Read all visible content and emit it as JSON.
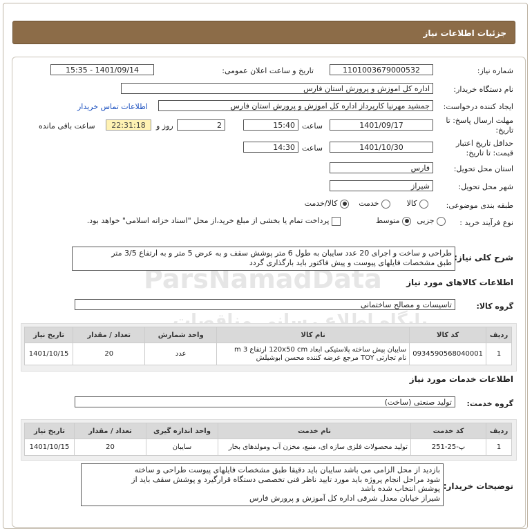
{
  "header": {
    "title": "جزئیات اطلاعات نیاز"
  },
  "fields": {
    "need_number_label": "شماره نیاز:",
    "need_number": "1101003679000532",
    "announce_label": "تاریخ و ساعت اعلان عمومی:",
    "announce_value": "1401/09/14 - 15:35",
    "buyer_org_label": "نام دستگاه خریدار:",
    "buyer_org": "اداره کل اموزش و پرورش استان فارس",
    "creator_label": "ایجاد کننده درخواست:",
    "creator": "جمشید مهرنیا کارپرداز اداره کل اموزش و پرورش استان فارس",
    "contact_link": "اطلاعات تماس خریدار",
    "deadline_label_1": "مهلت ارسال پاسخ: تا",
    "deadline_label_2": "تاریخ:",
    "deadline_date": "1401/09/17",
    "time_label": "ساعت",
    "deadline_time": "15:40",
    "days_value": "2",
    "days_label": "روز و",
    "remaining_time": "22:31:18",
    "remaining_label": "ساعت باقی مانده",
    "validity_label_1": "حداقل تاریخ اعتبار",
    "validity_label_2": "قیمت: تا تاریخ:",
    "validity_date": "1401/10/30",
    "validity_time": "14:30",
    "province_label": "استان محل تحویل:",
    "province": "فارس",
    "city_label": "شهر محل تحویل:",
    "city": "شیراز",
    "category_label": "طبقه بندی موضوعی:",
    "category_options": [
      "کالا",
      "خدمت",
      "کالا/خدمت"
    ],
    "process_label": "نوع فرآیند خرید :",
    "process_options": [
      "جزیی",
      "متوسط"
    ],
    "payment_note": "پرداخت تمام یا بخشی از مبلغ خرید،از محل \"اسناد خزانه اسلامی\" خواهد بود."
  },
  "summary": {
    "label": "شرح کلی نیاز:",
    "line1": "طراحی و ساخت و اجرای 20 عدد سایبان به طول 6 متر پوشش سقف و به عرض 5 متر و به ارتفاع 3/5 متر",
    "line2": "طبق مشخصات فایلهای پیوست  و پیش فاکتور باید بارگذاری گردد"
  },
  "goods": {
    "section_title": "اطلاعات کالاهای مورد نیاز",
    "group_label": "گروه کالا:",
    "group_value": "تاسیسات و مصالح ساختمانی",
    "columns": [
      "ردیف",
      "کد کالا",
      "نام کالا",
      "واحد شمارش",
      "تعداد / مقدار",
      "تاریخ نیاز"
    ],
    "rows": [
      {
        "idx": "1",
        "code": "0934590568040001",
        "name_1": "سایبان پیش ساخته پلاستیکی ابعاد 120x50 cm ارتفاع 3 m",
        "name_2": "نام تجارتی TOY مرجع عرضه کننده محسن ابوشیلش",
        "unit": "عدد",
        "qty": "20",
        "date": "1401/10/15"
      }
    ]
  },
  "services": {
    "section_title": "اطلاعات خدمات مورد نیاز",
    "group_label": "گروه خدمت:",
    "group_value": "تولید صنعتی (ساخت)",
    "columns": [
      "ردیف",
      "کد خدمت",
      "نام خدمت",
      "واحد اندازه گیری",
      "تعداد / مقدار",
      "تاریخ نیاز"
    ],
    "rows": [
      {
        "idx": "1",
        "code": "پ-25-251",
        "name": "تولید محصولات فلزی سازه ای، منبع، مخزن آب ومولدهای بخار",
        "unit": "سایبان",
        "qty": "20",
        "date": "1401/10/15"
      }
    ]
  },
  "notes": {
    "label": "توضیحات خریدار:",
    "lines": [
      "بازدید از محل الزامی می باشد سایبان باید دقیقا طبق مشخصات فایلهای پیوست طراحی و ساخته",
      "شود مراحل انجام پروژه  باید مورد تایید ناظر فنی تخصصی دستگاه قرارگیرد و پوشش سقف باید از",
      "پوشش انتخاب شده باشد",
      "شیراز خیابان معدل شرقی اداره کل آموزش و پرورش فارس"
    ]
  },
  "watermark": {
    "brand": "ParsNamadData",
    "persian": "پایگاه اطلاع رسانی مناقصات"
  },
  "colors": {
    "header_bg": "#8c6c48",
    "remaining_bg": "#fff2b3",
    "link": "#1a4fbf"
  }
}
